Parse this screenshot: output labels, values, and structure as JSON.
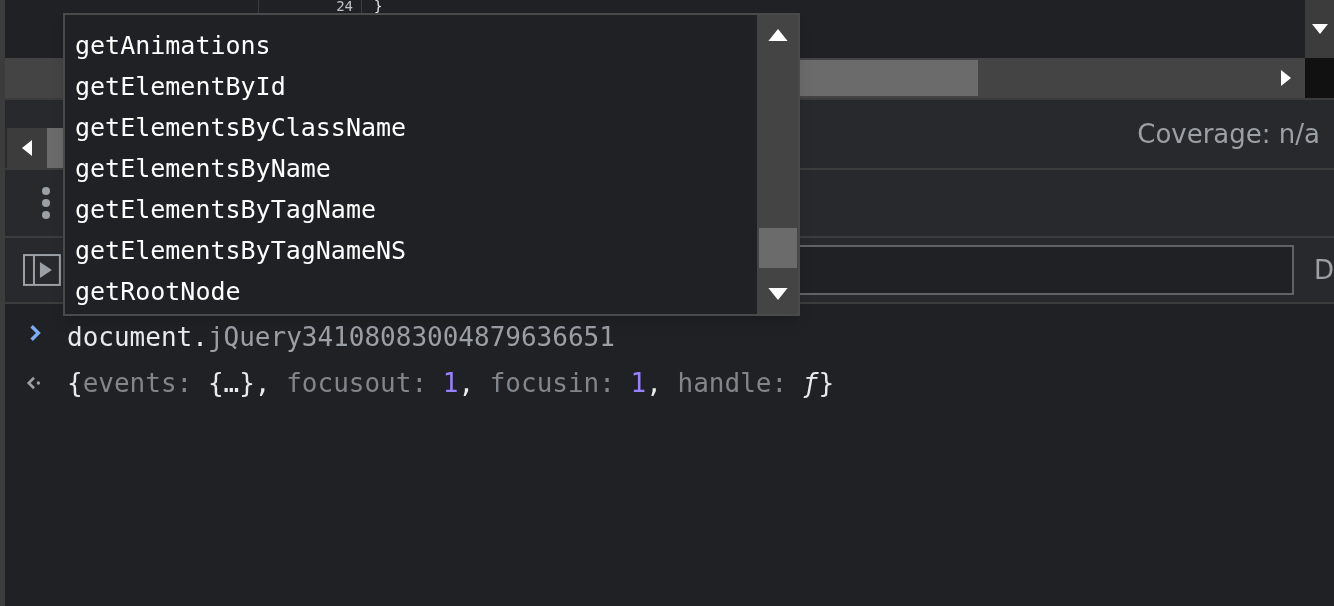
{
  "editor": {
    "line_number": "24",
    "code": "}"
  },
  "coverage": "Coverage: n/a",
  "filter": {
    "cut_label": "D"
  },
  "console": [
    {
      "kind": "input",
      "segments": [
        {
          "text": "document.",
          "kind": "plain"
        },
        {
          "text": "jQuery34108083004879636651",
          "kind": "dim"
        }
      ]
    },
    {
      "kind": "result",
      "segments": [
        {
          "text": "{",
          "kind": "plain"
        },
        {
          "text": "events: ",
          "kind": "key"
        },
        {
          "text": "{…}, ",
          "kind": "plain"
        },
        {
          "text": "focusout: ",
          "kind": "key"
        },
        {
          "text": "1",
          "kind": "number"
        },
        {
          "text": ", ",
          "kind": "plain"
        },
        {
          "text": "focusin: ",
          "kind": "key"
        },
        {
          "text": "1",
          "kind": "number"
        },
        {
          "text": ", ",
          "kind": "plain"
        },
        {
          "text": "handle: ",
          "kind": "key"
        },
        {
          "text": "ƒ",
          "kind": "fn"
        },
        {
          "text": "}",
          "kind": "plain"
        }
      ]
    }
  ],
  "autocomplete": {
    "items": [
      {
        "label": "getAnimations",
        "selected": false
      },
      {
        "label": "getElementById",
        "selected": false
      },
      {
        "label": "getElementsByClassName",
        "selected": false
      },
      {
        "label": "getElementsByName",
        "selected": false
      },
      {
        "label": "getElementsByTagName",
        "selected": false
      },
      {
        "label": "getElementsByTagNameNS",
        "selected": false
      },
      {
        "label": "getRootNode",
        "selected": false
      }
    ]
  }
}
